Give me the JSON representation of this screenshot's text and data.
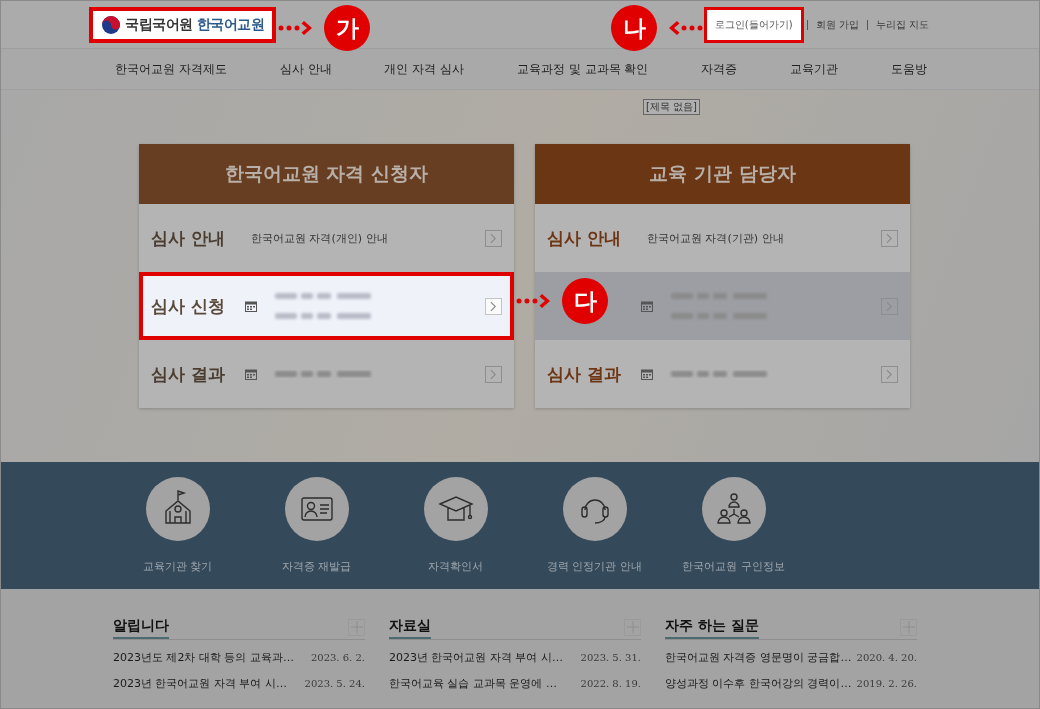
{
  "header": {
    "logo": {
      "org": "국립국어원",
      "site": "한국어교원",
      "highlighted": true
    },
    "links": [
      {
        "label": "로그인(들어가기)",
        "highlighted": true
      },
      {
        "label": "회원 가입",
        "highlighted": false
      },
      {
        "label": "누리집 지도",
        "highlighted": false
      }
    ]
  },
  "nav": [
    "한국어교원 자격제도",
    "심사 안내",
    "개인 자격 심사",
    "교육과정 및 교과목 확인",
    "자격증",
    "교육기관",
    "도움방"
  ],
  "banner_caption": "[제목 없음]",
  "cards": [
    {
      "title": "한국어교원 자격 신청자",
      "rows": [
        {
          "kind": "info",
          "label": "심사 안내",
          "text": "한국어교원 자격(개인) 안내",
          "highlighted": false,
          "shaded": false
        },
        {
          "kind": "period",
          "label": "심사 신청",
          "highlighted": true,
          "shaded": false
        },
        {
          "kind": "date",
          "label": "심사 결과",
          "highlighted": false,
          "shaded": false
        }
      ]
    },
    {
      "title": "교육 기관 담당자",
      "rows": [
        {
          "kind": "info",
          "label": "심사 안내",
          "text": "한국어교원 자격(기관) 안내",
          "highlighted": false,
          "shaded": false
        },
        {
          "kind": "period",
          "highlighted": false,
          "shaded": true
        },
        {
          "kind": "date",
          "label": "심사 결과",
          "highlighted": false,
          "shaded": false
        }
      ]
    }
  ],
  "quick_links": [
    {
      "kind": "school",
      "label": "교육기관 찾기"
    },
    {
      "kind": "id-card",
      "label": "자격증 재발급"
    },
    {
      "kind": "cap",
      "label": "자격확인서"
    },
    {
      "kind": "headset",
      "label": "경력 인정기관 안내"
    },
    {
      "kind": "people",
      "label": "한국어교원 구인정보"
    }
  ],
  "boards": [
    {
      "title": "알립니다",
      "items": [
        {
          "title": "2023년도 제2차 대학 등의 교육과…",
          "date": "2023. 6. 2."
        },
        {
          "title": "2023년 한국어교원 자격 부여 시…",
          "date": "2023. 5. 24."
        }
      ]
    },
    {
      "title": "자료실",
      "items": [
        {
          "title": "2023년 한국어교원 자격 부여 시…",
          "date": "2023. 5. 31."
        },
        {
          "title": "한국어교육 실습 교과목 운영에 …",
          "date": "2022. 8. 19."
        }
      ]
    },
    {
      "title": "자주 하는 질문",
      "items": [
        {
          "title": "한국어교원 자격증 영문명이 궁금합…",
          "date": "2020. 4. 20."
        },
        {
          "title": "양성과정 이수후 한국어강의 경력이…",
          "date": "2019. 2. 26."
        }
      ]
    }
  ],
  "markers": [
    {
      "label": "가",
      "kind": "arrow-before"
    },
    {
      "label": "나",
      "kind": "arrow-after"
    },
    {
      "label": "다",
      "kind": "arrow-before"
    }
  ]
}
